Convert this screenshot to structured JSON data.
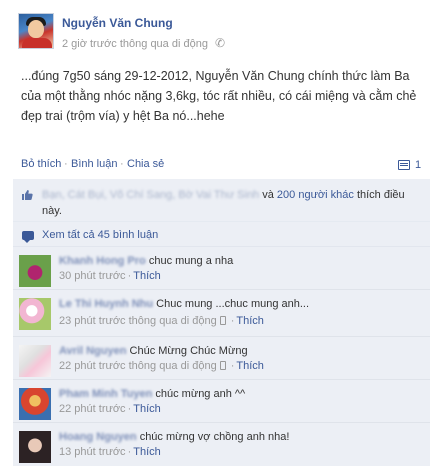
{
  "post": {
    "author": "Nguyễn Văn Chung",
    "time": "2 giờ trước thông qua di động",
    "text": "...đúng 7g50 sáng 29-12-2012, Nguyễn Văn Chung chính thức làm Ba của một thằng nhóc nặng 3,6kg, tóc rất nhiều, có cái miệng và cằm chẻ đẹp trai (trộm vía) y hệt Ba nó...hehe"
  },
  "actions": {
    "like": "Bỏ thích",
    "comment": "Bình luận",
    "share": "Chia sẻ",
    "separator": "·",
    "comment_count": "1"
  },
  "likes": {
    "names_blurred": "Bạn, Cát Bụi, Võ Chí Sang, Bờ Vai Thư Sinh",
    "and": " và ",
    "others": "200 người khác",
    "suffix": " thích điều này."
  },
  "view_all_comments": "Xem tất cả 45 bình luận",
  "comments": [
    {
      "name": "Khanh Hong Pro",
      "text": "chuc mung a nha",
      "time": "30 phút trước",
      "via": "",
      "like": "Thích"
    },
    {
      "name": "Le Thi Huynh Nhu",
      "text": "Chuc mung ...chuc mung anh...",
      "time": "23 phút trước thông qua di động",
      "via": "mobile",
      "like": "Thích"
    },
    {
      "name": "Avril Nguyen",
      "text": "Chúc Mừng Chúc Mừng",
      "time": "22 phút trước thông qua di động",
      "via": "mobile",
      "like": "Thích"
    },
    {
      "name": "Pham Minh Tuyen",
      "text": "chúc mừng anh ^^",
      "time": "22 phút trước",
      "via": "",
      "like": "Thích"
    },
    {
      "name": "Hoang Nguyen",
      "text": "chúc mừng vợ chồng anh nha!",
      "time": "13 phút trước",
      "via": "",
      "like": "Thích"
    }
  ],
  "colors": {
    "link": "#3b5998",
    "feedback_bg": "#eceff5",
    "meta_text": "#999999"
  }
}
